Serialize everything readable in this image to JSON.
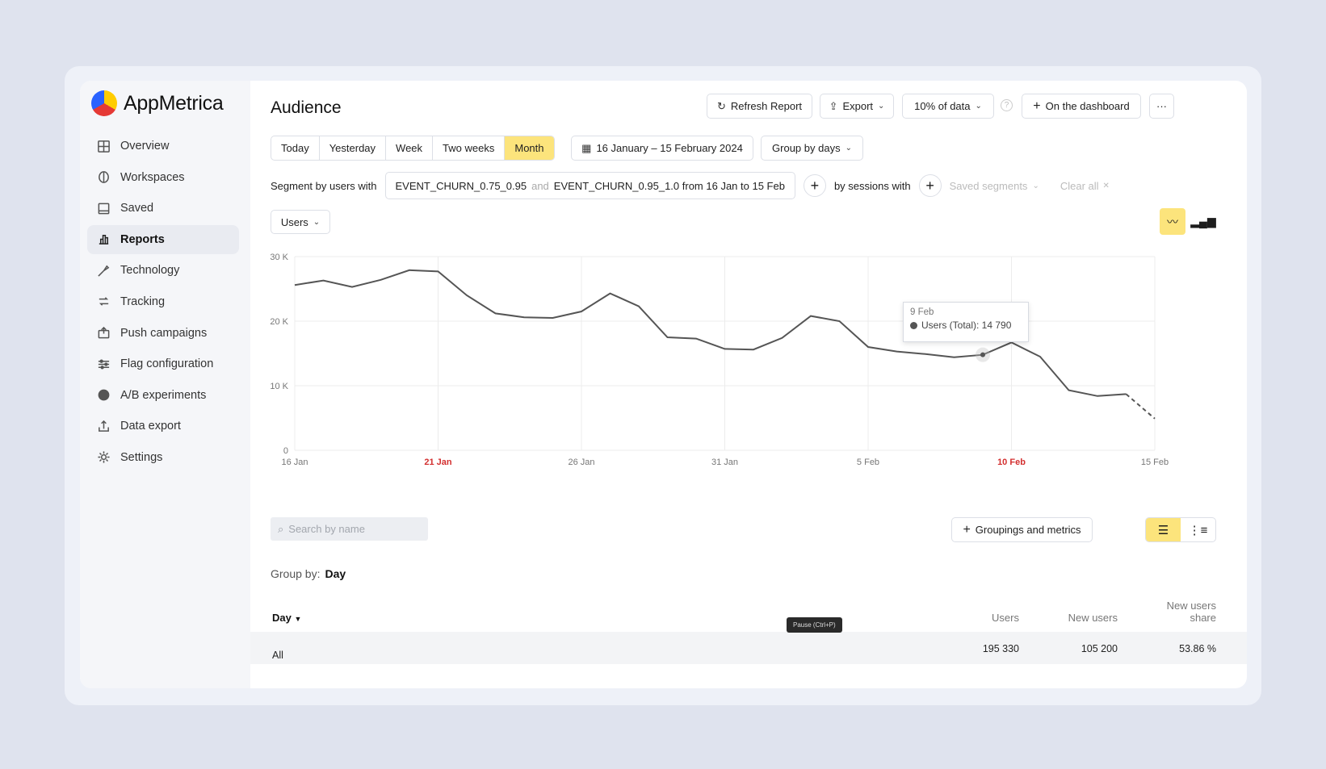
{
  "app": {
    "name": "AppMetrica"
  },
  "sidebar": {
    "items": [
      {
        "label": "Overview",
        "icon": "grid-icon"
      },
      {
        "label": "Workspaces",
        "icon": "workspaces-icon"
      },
      {
        "label": "Saved",
        "icon": "saved-icon"
      },
      {
        "label": "Reports",
        "icon": "reports-icon",
        "active": true
      },
      {
        "label": "Technology",
        "icon": "technology-icon"
      },
      {
        "label": "Tracking",
        "icon": "tracking-icon"
      },
      {
        "label": "Push campaigns",
        "icon": "push-icon"
      },
      {
        "label": "Flag configuration",
        "icon": "flag-config-icon"
      },
      {
        "label": "A/B experiments",
        "icon": "ab-icon"
      },
      {
        "label": "Data export",
        "icon": "export-icon"
      },
      {
        "label": "Settings",
        "icon": "gear-icon"
      }
    ]
  },
  "header": {
    "title": "Audience",
    "refresh_label": "Refresh Report",
    "export_label": "Export",
    "sampling_label": "10% of data",
    "dashboard_label": "On the dashboard",
    "more_label": "···"
  },
  "periods": [
    {
      "label": "Today"
    },
    {
      "label": "Yesterday"
    },
    {
      "label": "Week"
    },
    {
      "label": "Two weeks"
    },
    {
      "label": "Month",
      "active": true
    }
  ],
  "date_range": "16 January – 15 February 2024",
  "group_by_dropdown": "Group by days",
  "segment": {
    "label": "Segment by users with",
    "event1": "EVENT_CHURN_0.75_0.95",
    "and": "and",
    "event2": "EVENT_CHURN_0.95_1.0 from 16 Jan to 15 Feb",
    "sessions_label": "by sessions with",
    "saved_segments": "Saved segments",
    "clear_all": "Clear all"
  },
  "metric_dropdown": "Users",
  "tooltip": {
    "date": "9 Feb",
    "text": "Users (Total): 14 790"
  },
  "chart_data": {
    "type": "line",
    "series": [
      {
        "name": "Users (Total)",
        "x": [
          "16 Jan",
          "17 Jan",
          "18 Jan",
          "19 Jan",
          "20 Jan",
          "21 Jan",
          "22 Jan",
          "23 Jan",
          "24 Jan",
          "25 Jan",
          "26 Jan",
          "27 Jan",
          "28 Jan",
          "29 Jan",
          "30 Jan",
          "31 Jan",
          "1 Feb",
          "2 Feb",
          "3 Feb",
          "4 Feb",
          "5 Feb",
          "6 Feb",
          "7 Feb",
          "8 Feb",
          "9 Feb",
          "10 Feb",
          "11 Feb",
          "12 Feb",
          "13 Feb",
          "14 Feb",
          "15 Feb"
        ],
        "values": [
          25600,
          26300,
          25300,
          26400,
          27900,
          27700,
          24000,
          21200,
          20600,
          20500,
          21500,
          24300,
          22300,
          17500,
          17300,
          15700,
          15600,
          17400,
          20800,
          20000,
          16000,
          15300,
          14900,
          14400,
          14790,
          16700,
          14500,
          9300,
          8400,
          8700,
          4900
        ],
        "incomplete_from": "14 Feb"
      }
    ],
    "y_ticks": [
      "0",
      "10 K",
      "20 K",
      "30 K"
    ],
    "ylim": [
      0,
      30000
    ],
    "x_ticks": [
      {
        "label": "16 Jan",
        "weekend": false
      },
      {
        "label": "21 Jan",
        "weekend": true
      },
      {
        "label": "26 Jan",
        "weekend": false
      },
      {
        "label": "31 Jan",
        "weekend": false
      },
      {
        "label": "5 Feb",
        "weekend": false
      },
      {
        "label": "10 Feb",
        "weekend": true
      },
      {
        "label": "15 Feb",
        "weekend": false
      }
    ],
    "grid": true,
    "line_color": "#555555",
    "weekend_color": "#d32f2f"
  },
  "search": {
    "placeholder": "Search by name"
  },
  "groupings_label": "Groupings and metrics",
  "table": {
    "group_by_label": "Group by:",
    "group_by_value": "Day",
    "columns": [
      "Day",
      "Users",
      "New users",
      "New users share"
    ],
    "rows": [
      {
        "day": "All",
        "users": "195 330",
        "new_users": "105 200",
        "share": "53.86 %"
      }
    ]
  },
  "pause_tip": "Pause (Ctrl+P)",
  "colors": {
    "accent": "#fce47c",
    "background": "#dfe3ee"
  }
}
